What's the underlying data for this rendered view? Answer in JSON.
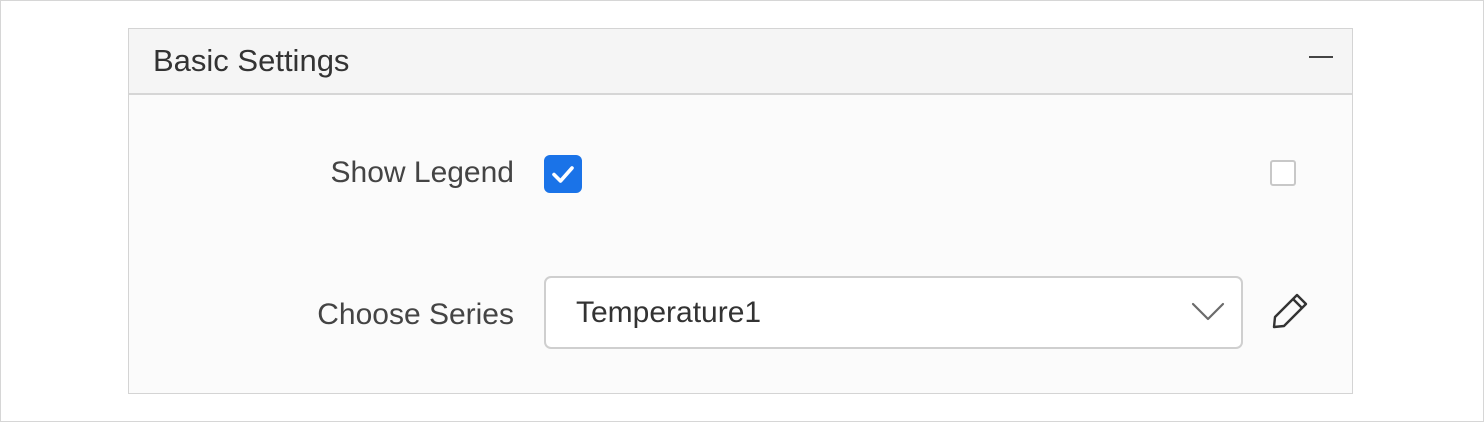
{
  "panel": {
    "title": "Basic Settings",
    "collapse_icon": "minus-icon"
  },
  "show_legend": {
    "label": "Show Legend",
    "checked": true,
    "secondary_checked": false
  },
  "choose_series": {
    "label": "Choose Series",
    "selected": "Temperature1",
    "edit_icon": "pencil-icon",
    "dropdown_icon": "chevron-down-icon"
  },
  "colors": {
    "accent": "#1a73e8",
    "text": "#333333",
    "border": "#cfcfcf"
  }
}
